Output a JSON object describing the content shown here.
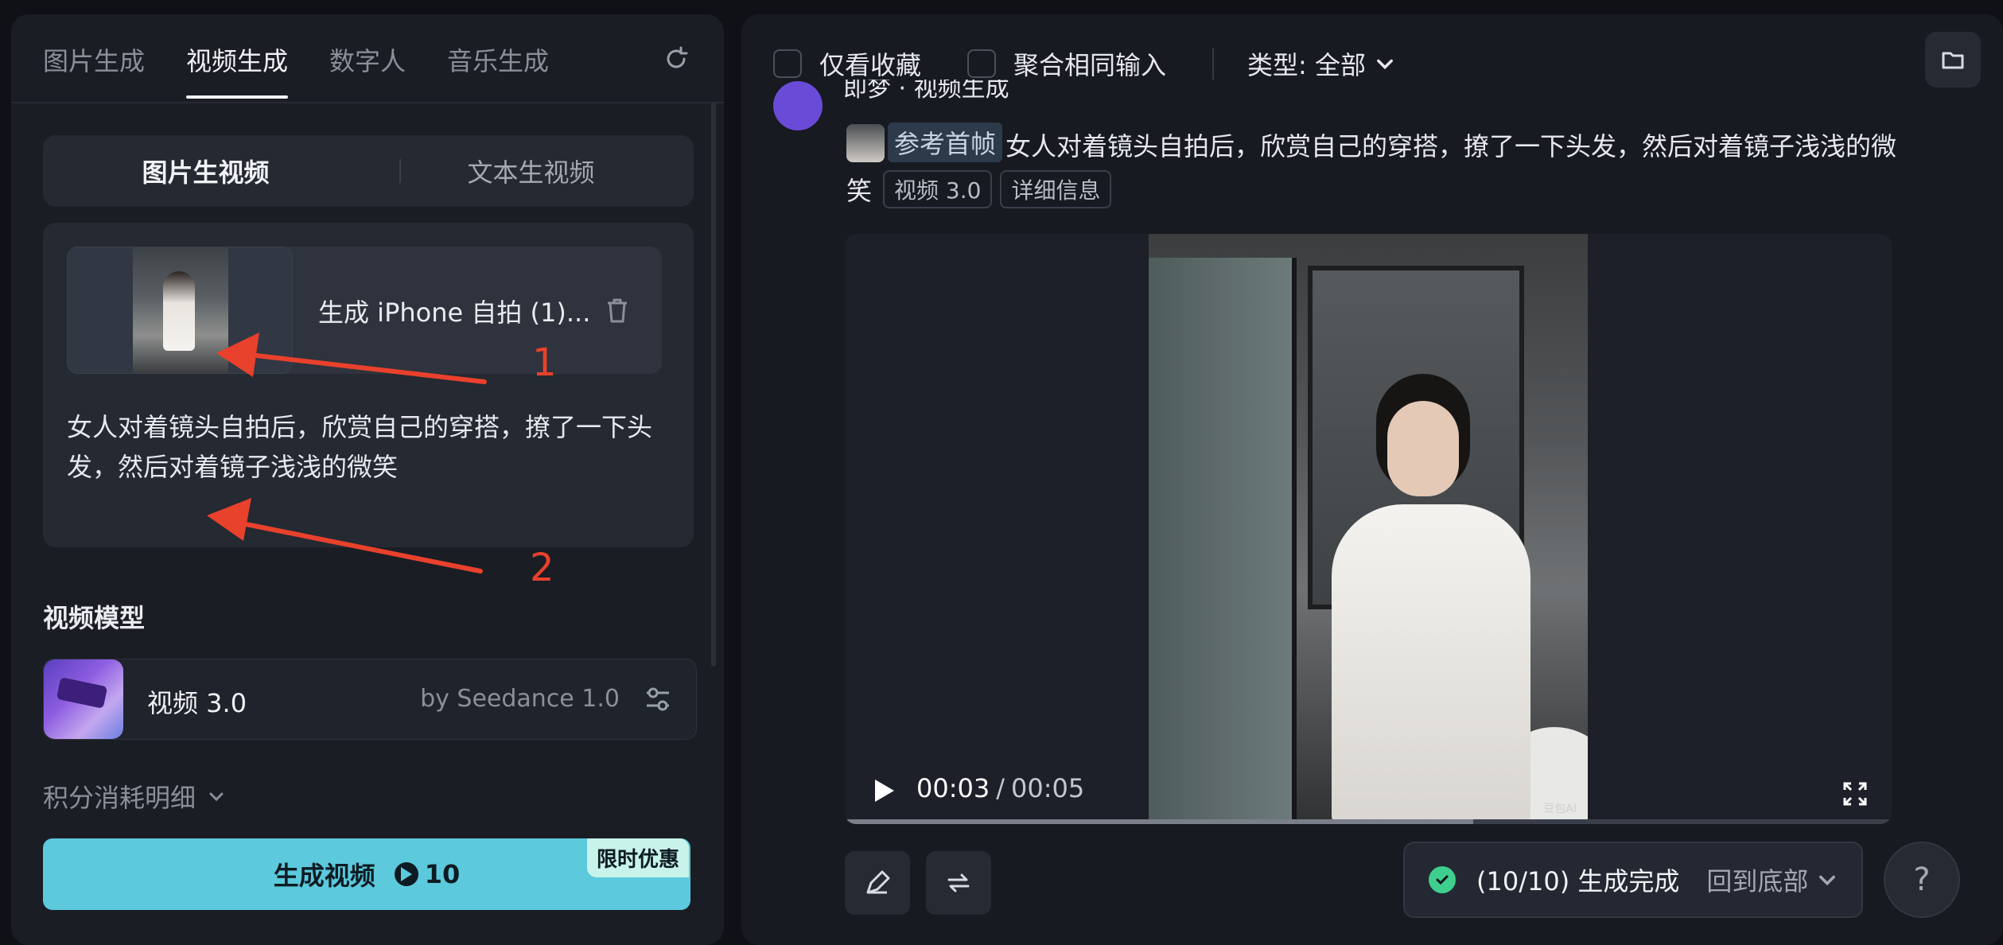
{
  "left_panel": {
    "tabs": [
      "图片生成",
      "视频生成",
      "数字人",
      "音乐生成"
    ],
    "active_tab": "视频生成",
    "mode_tabs": [
      "图片生视频",
      "文本生视频"
    ],
    "upload": {
      "file_name": "生成 iPhone 自拍 (1)...",
      "prompt": "女人对着镜头自拍后，欣赏自己的穿搭，撩了一下头发，然后对着镜子浅浅的微笑"
    },
    "annotations": {
      "arrow1": "1",
      "arrow2": "2"
    },
    "model_section_title": "视频模型",
    "model": {
      "name": "视频 3.0",
      "by": "by Seedance 1.0"
    },
    "cost_label": "积分消耗明细",
    "generate": {
      "label": "生成视频",
      "cost": "10",
      "promo": "限时优惠"
    }
  },
  "right_panel": {
    "toolbar": {
      "favorites_only": "仅看收藏",
      "merge_inputs": "聚合相同输入",
      "type_filter": "类型: 全部"
    },
    "message": {
      "header": "即梦 · 视频生成",
      "ref_tag": "参考首帧",
      "text": "女人对着镜头自拍后，欣赏自己的穿搭，撩了一下头发，然后对着镜子浅浅的微",
      "text_tail": "笑",
      "chips": [
        "视频 3.0",
        "详细信息"
      ]
    },
    "video": {
      "current_time": "00:03",
      "separator": "/",
      "duration": "00:05",
      "watermark": "豆包AI",
      "progress": 0.6
    },
    "status": {
      "text": "(10/10) 生成完成",
      "back_label": "回到底部"
    },
    "help_label": "?"
  },
  "colors": {
    "accent_button": "#5cc9dc",
    "success": "#3ecf8e",
    "annotation_red": "#e8412c"
  }
}
